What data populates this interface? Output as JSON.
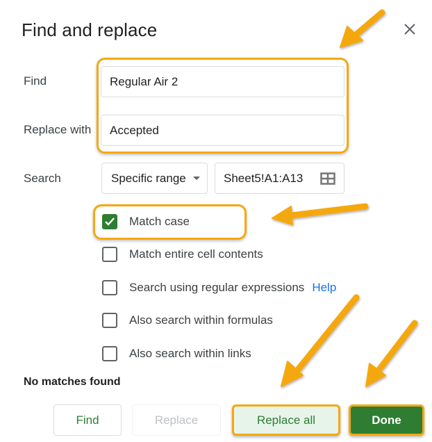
{
  "dialog": {
    "title": "Find and replace",
    "close_icon": "close-icon"
  },
  "form": {
    "find_label": "Find",
    "find_value": "Regular Air 2",
    "replace_label": "Replace with",
    "replace_value": "Accepted",
    "search_label": "Search",
    "search_scope": "Specific range",
    "range_value": "Sheet5!A1:A13",
    "range_icon": "grid-select-icon"
  },
  "options": [
    {
      "label": "Match case",
      "checked": true
    },
    {
      "label": "Match entire cell contents",
      "checked": false
    },
    {
      "label": "Search using regular expressions",
      "checked": false,
      "link": "Help"
    },
    {
      "label": "Also search within formulas",
      "checked": false
    },
    {
      "label": "Also search within links",
      "checked": false
    }
  ],
  "status": "No matches found",
  "buttons": {
    "find": "Find",
    "replace": "Replace",
    "replace_all": "Replace all",
    "done": "Done"
  },
  "annotations": {
    "highlight_color": "#f5a80f",
    "arrow_color": "#f5a80f"
  },
  "colors": {
    "accent_green": "#2e7d32",
    "light_green": "#e6f4ea",
    "link_blue": "#1a73e8"
  }
}
